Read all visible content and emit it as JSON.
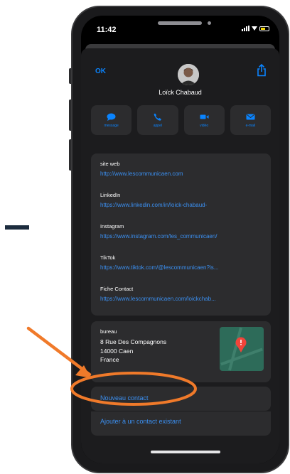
{
  "status": {
    "time": "11:42"
  },
  "header": {
    "ok": "OK"
  },
  "contact": {
    "name": "Loïck Chabaud"
  },
  "actions": [
    {
      "label": "message",
      "icon": "message-bubble-icon"
    },
    {
      "label": "appel",
      "icon": "phone-icon"
    },
    {
      "label": "vidéo",
      "icon": "video-camera-icon"
    },
    {
      "label": "e-mail",
      "icon": "mail-icon"
    }
  ],
  "links": [
    {
      "label": "site web",
      "value": "http://www.lescommunicaen.com"
    },
    {
      "label": "LinkedIn",
      "value": "https://www.linkedin.com/in/loick-chabaud-"
    },
    {
      "label": "Instagram",
      "value": "https://www.instagram.com/les_communicaen/"
    },
    {
      "label": "TikTok",
      "value": "https://www.tiktok.com/@lescommunicaen?is..."
    },
    {
      "label": "Fiche Contact",
      "value": "https://www.lescommunicaen.com/loickchab..."
    }
  ],
  "address": {
    "label": "bureau",
    "line1": "8 Rue Des Compagnons",
    "line2": "14000 Caen",
    "line3": "France"
  },
  "buttons": {
    "new_contact": "Nouveau contact",
    "add_existing": "Ajouter à un contact existant"
  },
  "colors": {
    "accent": "#0a84ff",
    "annotation": "#f07a2a",
    "background": "#000000",
    "card": "#2c2c2e"
  }
}
